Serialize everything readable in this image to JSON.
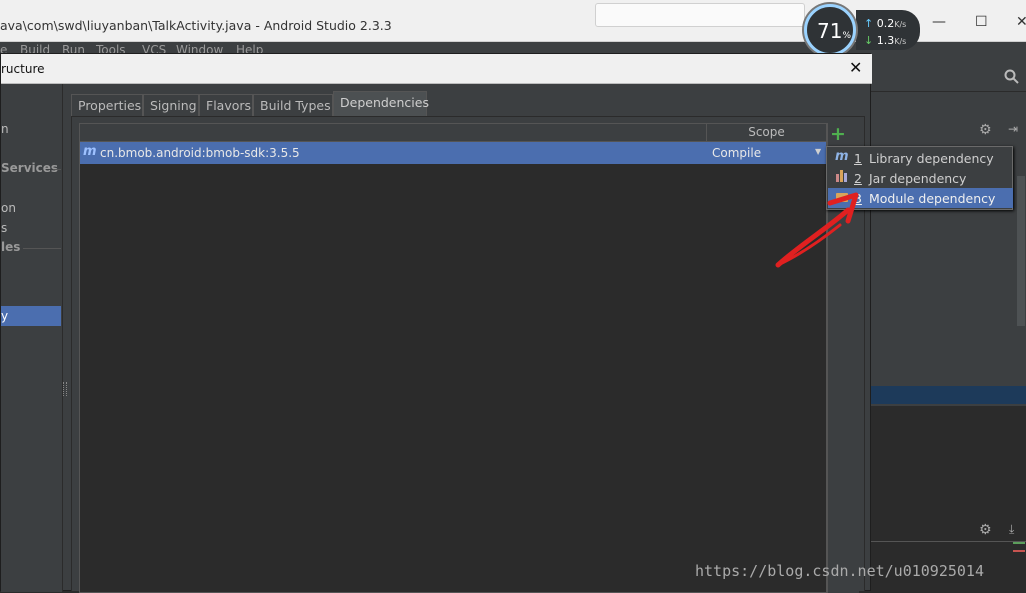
{
  "ide": {
    "title": "ava\\com\\swd\\liuyanban\\TalkActivity.java - Android Studio 2.3.3",
    "window_controls": [
      "—",
      "☐",
      "✕"
    ],
    "menu": [
      "e",
      "Build",
      "Run",
      "Tools",
      "VCS",
      "Window",
      "Help"
    ]
  },
  "perf_widget": {
    "percent": "71",
    "percent_sign": "%",
    "upload": "0.2",
    "download": "1.3",
    "unit": "K/s"
  },
  "dialog": {
    "title": "ructure",
    "close": "✕",
    "left_items": [
      "n",
      "Services",
      "on",
      "s",
      "les",
      "y"
    ],
    "tabs": [
      "Properties",
      "Signing",
      "Flavors",
      "Build Types",
      "Dependencies"
    ],
    "active_tab": "Dependencies",
    "table": {
      "scope_header": "Scope",
      "rows": [
        {
          "icon": "m",
          "name": "cn.bmob.android:bmob-sdk:3.5.5",
          "scope": "Compile"
        }
      ]
    },
    "add_button": "+"
  },
  "popup": {
    "items": [
      {
        "num": "1",
        "label": "Library dependency",
        "icon": "maven-m-icon"
      },
      {
        "num": "2",
        "label": "Jar dependency",
        "icon": "jar-icon"
      },
      {
        "num": "3",
        "label": "Module dependency",
        "icon": "module-folder-icon"
      }
    ],
    "selected_index": 2
  },
  "colors": {
    "dark_bg": "#3c3f41",
    "selection": "#4b6eaf",
    "annotation_arrow": "#e02020"
  },
  "watermark": "https://blog.csdn.net/u010925014"
}
